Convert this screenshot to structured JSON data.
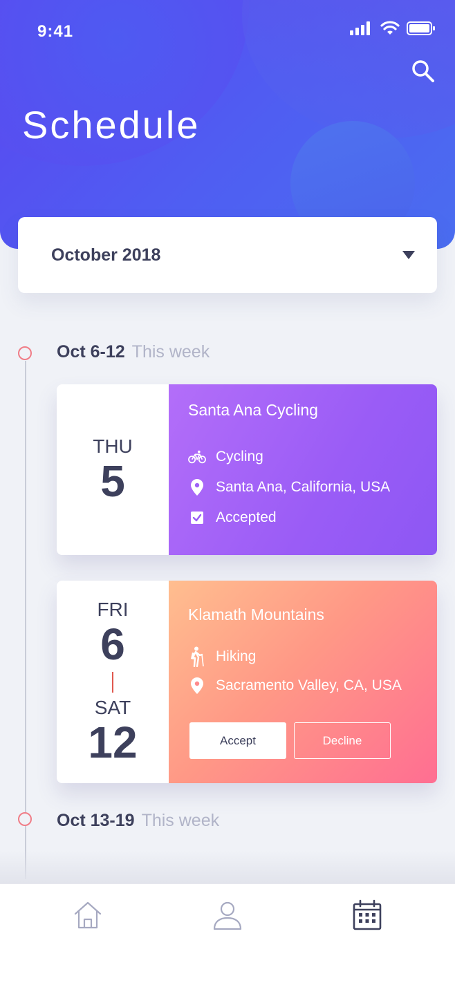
{
  "status_bar": {
    "time": "9:41"
  },
  "header": {
    "title": "Schedule",
    "search_icon": "search-icon"
  },
  "month_select": {
    "value": "October 2018",
    "icon": "caret-down-icon"
  },
  "weeks": [
    {
      "range": "Oct 6-12",
      "label": "This week"
    },
    {
      "range": "Oct 13-19",
      "label": "This week"
    }
  ],
  "events": [
    {
      "day_of_week": "THU",
      "day": "5",
      "title": "Santa Ana Cycling",
      "activity": "Cycling",
      "location": "Santa Ana, California, USA",
      "status": "Accepted",
      "gradient": [
        "#b36ef9",
        "#8d57f4"
      ]
    },
    {
      "start_dow": "FRI",
      "start_day": "6",
      "end_dow": "SAT",
      "end_day": "12",
      "title": "Klamath Mountains",
      "activity": "Hiking",
      "location": "Sacramento Valley, CA, USA",
      "accept_label": "Accept",
      "decline_label": "Decline",
      "gradient": [
        "#ffbe8f",
        "#ff6e92"
      ]
    }
  ],
  "tabbar": {
    "items": [
      {
        "icon": "home-icon",
        "active": false
      },
      {
        "icon": "profile-icon",
        "active": false
      },
      {
        "icon": "calendar-icon",
        "active": true
      }
    ]
  },
  "colors": {
    "accent": "#5a46f0",
    "timeline_dot": "#f07d87",
    "text_dark": "#3d405c",
    "text_muted": "#b1b4c8"
  }
}
